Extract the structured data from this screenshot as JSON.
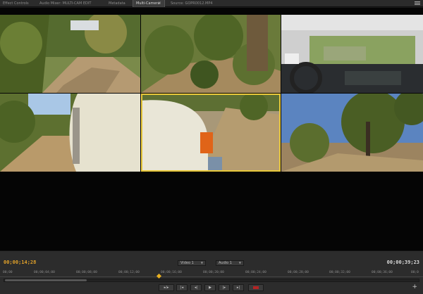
{
  "tabs": [
    {
      "label": "Effect Controls",
      "active": false
    },
    {
      "label": "Audio Mixer: MULTI-CAM EDIT",
      "active": false
    },
    {
      "label": "Metadata",
      "active": false
    },
    {
      "label": "Multi-Camera",
      "active": true
    },
    {
      "label": "Source: GOPR0012.MP4",
      "active": false
    }
  ],
  "timecode_current": "00;00;14;28",
  "timecode_duration": "00;00;39;23",
  "video_select": "Video 1",
  "audio_select": "Audio 1",
  "ruler_ticks": [
    "00;00",
    "00;00;04;00",
    "00;00;08;00",
    "00;00;12;00",
    "00;00;16;00",
    "00;00;20;00",
    "00;00;24;00",
    "00;00;28;00",
    "00;00;32;00",
    "00;00;36;00",
    "00;0"
  ],
  "playhead_fraction": 0.376,
  "transport": [
    "▸/▸",
    "|◂",
    "◂|",
    "▶",
    "|▸",
    "▸|"
  ],
  "colors": {
    "accent": "#e0a12a",
    "selected_outline": "#e8c83a",
    "record": "#b52424"
  },
  "icons": {
    "close": "close-icon",
    "menu": "panel-menu-icon",
    "add": "add-icon"
  }
}
